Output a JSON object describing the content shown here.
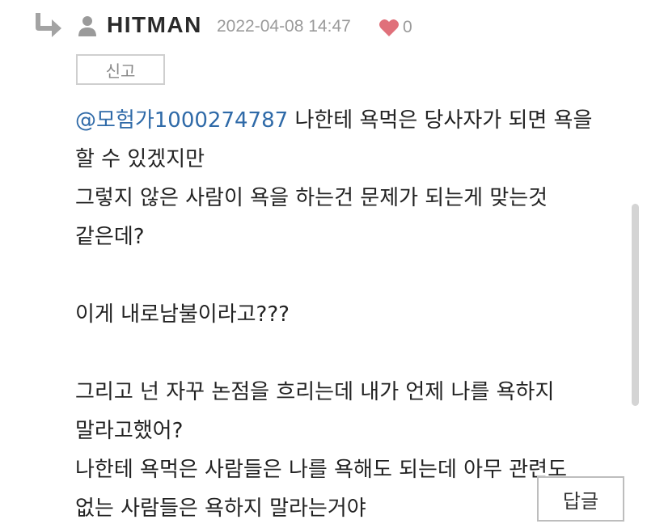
{
  "comment": {
    "icons": {
      "reply_indicator": "reply-arrow-icon",
      "author": "user-icon",
      "like": "heart-icon"
    },
    "author": "HITMAN",
    "timestamp": "2022-04-08 14:47",
    "like_count": "0",
    "report_label": "신고",
    "mention": "@모험가1000274787",
    "lines": [
      " 나한테 욕먹은 당사자가 되면 욕을",
      "할 수 있겠지만",
      "그렇지 않은 사람이 욕을 하는건 문제가 되는게 맞는것",
      "같은데?",
      "",
      "이게 내로남불이라고???",
      "",
      "그리고 넌 자꾸 논점을 흐리는데 내가 언제 나를 욕하지",
      "말라고했어?",
      "나한테 욕먹은 사람들은 나를 욕해도 되는데 아무 관련도",
      "없는 사람들은 욕하지 말라는거야"
    ],
    "reply_label": "답글"
  },
  "colors": {
    "mention": "#2f6aa8",
    "heart": "#e0707a",
    "meta_text": "#9a9a9a"
  }
}
